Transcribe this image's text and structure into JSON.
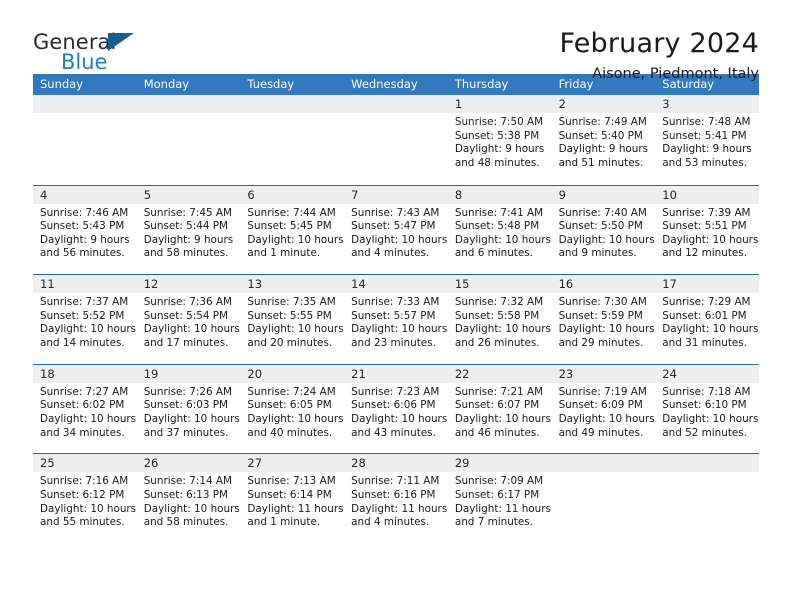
{
  "brand": {
    "name_top": "General",
    "name_bottom": "Blue",
    "flag_color": "#14618f",
    "blue_color": "#1f7ec4"
  },
  "header": {
    "title": "February 2024",
    "subtitle": "Aisone, Piedmont, Italy"
  },
  "theme": {
    "header_row_bg": "#3278be",
    "row_divider": "#1f6bb0",
    "daynum_band_bg": "#efefef"
  },
  "weekdays": [
    "Sunday",
    "Monday",
    "Tuesday",
    "Wednesday",
    "Thursday",
    "Friday",
    "Saturday"
  ],
  "weeks": [
    [
      {
        "day": "",
        "lines": []
      },
      {
        "day": "",
        "lines": []
      },
      {
        "day": "",
        "lines": []
      },
      {
        "day": "",
        "lines": []
      },
      {
        "day": "1",
        "lines": [
          "Sunrise: 7:50 AM",
          "Sunset: 5:38 PM",
          "Daylight: 9 hours",
          "and 48 minutes."
        ]
      },
      {
        "day": "2",
        "lines": [
          "Sunrise: 7:49 AM",
          "Sunset: 5:40 PM",
          "Daylight: 9 hours",
          "and 51 minutes."
        ]
      },
      {
        "day": "3",
        "lines": [
          "Sunrise: 7:48 AM",
          "Sunset: 5:41 PM",
          "Daylight: 9 hours",
          "and 53 minutes."
        ]
      }
    ],
    [
      {
        "day": "4",
        "lines": [
          "Sunrise: 7:46 AM",
          "Sunset: 5:43 PM",
          "Daylight: 9 hours",
          "and 56 minutes."
        ]
      },
      {
        "day": "5",
        "lines": [
          "Sunrise: 7:45 AM",
          "Sunset: 5:44 PM",
          "Daylight: 9 hours",
          "and 58 minutes."
        ]
      },
      {
        "day": "6",
        "lines": [
          "Sunrise: 7:44 AM",
          "Sunset: 5:45 PM",
          "Daylight: 10 hours",
          "and 1 minute."
        ]
      },
      {
        "day": "7",
        "lines": [
          "Sunrise: 7:43 AM",
          "Sunset: 5:47 PM",
          "Daylight: 10 hours",
          "and 4 minutes."
        ]
      },
      {
        "day": "8",
        "lines": [
          "Sunrise: 7:41 AM",
          "Sunset: 5:48 PM",
          "Daylight: 10 hours",
          "and 6 minutes."
        ]
      },
      {
        "day": "9",
        "lines": [
          "Sunrise: 7:40 AM",
          "Sunset: 5:50 PM",
          "Daylight: 10 hours",
          "and 9 minutes."
        ]
      },
      {
        "day": "10",
        "lines": [
          "Sunrise: 7:39 AM",
          "Sunset: 5:51 PM",
          "Daylight: 10 hours",
          "and 12 minutes."
        ]
      }
    ],
    [
      {
        "day": "11",
        "lines": [
          "Sunrise: 7:37 AM",
          "Sunset: 5:52 PM",
          "Daylight: 10 hours",
          "and 14 minutes."
        ]
      },
      {
        "day": "12",
        "lines": [
          "Sunrise: 7:36 AM",
          "Sunset: 5:54 PM",
          "Daylight: 10 hours",
          "and 17 minutes."
        ]
      },
      {
        "day": "13",
        "lines": [
          "Sunrise: 7:35 AM",
          "Sunset: 5:55 PM",
          "Daylight: 10 hours",
          "and 20 minutes."
        ]
      },
      {
        "day": "14",
        "lines": [
          "Sunrise: 7:33 AM",
          "Sunset: 5:57 PM",
          "Daylight: 10 hours",
          "and 23 minutes."
        ]
      },
      {
        "day": "15",
        "lines": [
          "Sunrise: 7:32 AM",
          "Sunset: 5:58 PM",
          "Daylight: 10 hours",
          "and 26 minutes."
        ]
      },
      {
        "day": "16",
        "lines": [
          "Sunrise: 7:30 AM",
          "Sunset: 5:59 PM",
          "Daylight: 10 hours",
          "and 29 minutes."
        ]
      },
      {
        "day": "17",
        "lines": [
          "Sunrise: 7:29 AM",
          "Sunset: 6:01 PM",
          "Daylight: 10 hours",
          "and 31 minutes."
        ]
      }
    ],
    [
      {
        "day": "18",
        "lines": [
          "Sunrise: 7:27 AM",
          "Sunset: 6:02 PM",
          "Daylight: 10 hours",
          "and 34 minutes."
        ]
      },
      {
        "day": "19",
        "lines": [
          "Sunrise: 7:26 AM",
          "Sunset: 6:03 PM",
          "Daylight: 10 hours",
          "and 37 minutes."
        ]
      },
      {
        "day": "20",
        "lines": [
          "Sunrise: 7:24 AM",
          "Sunset: 6:05 PM",
          "Daylight: 10 hours",
          "and 40 minutes."
        ]
      },
      {
        "day": "21",
        "lines": [
          "Sunrise: 7:23 AM",
          "Sunset: 6:06 PM",
          "Daylight: 10 hours",
          "and 43 minutes."
        ]
      },
      {
        "day": "22",
        "lines": [
          "Sunrise: 7:21 AM",
          "Sunset: 6:07 PM",
          "Daylight: 10 hours",
          "and 46 minutes."
        ]
      },
      {
        "day": "23",
        "lines": [
          "Sunrise: 7:19 AM",
          "Sunset: 6:09 PM",
          "Daylight: 10 hours",
          "and 49 minutes."
        ]
      },
      {
        "day": "24",
        "lines": [
          "Sunrise: 7:18 AM",
          "Sunset: 6:10 PM",
          "Daylight: 10 hours",
          "and 52 minutes."
        ]
      }
    ],
    [
      {
        "day": "25",
        "lines": [
          "Sunrise: 7:16 AM",
          "Sunset: 6:12 PM",
          "Daylight: 10 hours",
          "and 55 minutes."
        ]
      },
      {
        "day": "26",
        "lines": [
          "Sunrise: 7:14 AM",
          "Sunset: 6:13 PM",
          "Daylight: 10 hours",
          "and 58 minutes."
        ]
      },
      {
        "day": "27",
        "lines": [
          "Sunrise: 7:13 AM",
          "Sunset: 6:14 PM",
          "Daylight: 11 hours",
          "and 1 minute."
        ]
      },
      {
        "day": "28",
        "lines": [
          "Sunrise: 7:11 AM",
          "Sunset: 6:16 PM",
          "Daylight: 11 hours",
          "and 4 minutes."
        ]
      },
      {
        "day": "29",
        "lines": [
          "Sunrise: 7:09 AM",
          "Sunset: 6:17 PM",
          "Daylight: 11 hours",
          "and 7 minutes."
        ]
      },
      {
        "day": "",
        "lines": []
      },
      {
        "day": "",
        "lines": []
      }
    ]
  ]
}
